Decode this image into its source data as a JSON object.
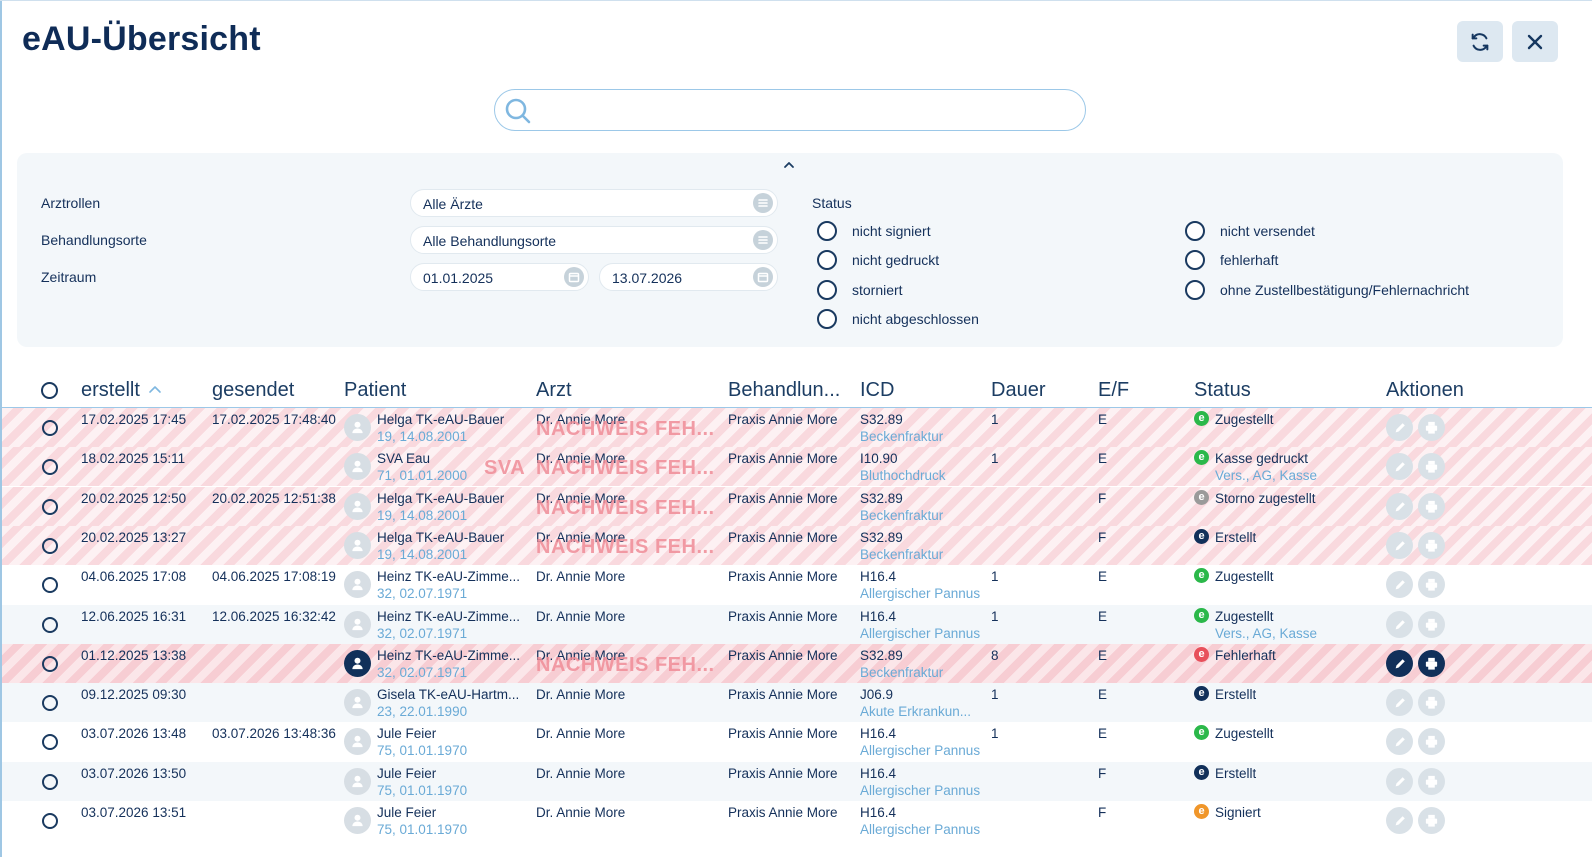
{
  "title": "eAU-Übersicht",
  "search": {
    "value": "",
    "placeholder": ""
  },
  "filters": {
    "arztrollen_label": "Arztrollen",
    "arztrollen_value": "Alle Ärzte",
    "behandlungsorte_label": "Behandlungsorte",
    "behandlungsorte_value": "Alle Behandlungsorte",
    "zeitraum_label": "Zeitraum",
    "zeitraum_from": "01.01.2025",
    "zeitraum_to": "13.07.2026",
    "status_title": "Status",
    "status_options": [
      "nicht signiert",
      "nicht gedruckt",
      "storniert",
      "nicht abgeschlossen",
      "nicht versendet",
      "fehlerhaft",
      "ohne Zustellbestätigung/Fehlernachricht"
    ]
  },
  "table": {
    "headers": [
      "erstellt",
      "gesendet",
      "Patient",
      "Arzt",
      "Behandlun...",
      "ICD",
      "Dauer",
      "E/F",
      "Status",
      "Aktionen"
    ],
    "rows": [
      {
        "erstellt": "17.02.2025 17:45",
        "gesendet": "17.02.2025 17:48:40",
        "patient": "Helga TK-eAU-Bauer",
        "patient_sub": "19, 14.08.2001",
        "arzt": "Dr. Annie More",
        "ort": "Praxis Annie More",
        "icd": "S32.89",
        "icd_sub": "Beckenfraktur",
        "dauer": "1",
        "ef": "E",
        "status": "Zugestellt",
        "status_sub": "",
        "status_color": "#2bb84a",
        "style": "err",
        "watermark": "NACHWEIS FEH...",
        "watermark_prefix": ""
      },
      {
        "erstellt": "18.02.2025 15:11",
        "gesendet": "",
        "patient": "SVA Eau",
        "patient_sub": "71, 01.01.2000",
        "arzt": "Dr. Annie More",
        "ort": "Praxis Annie More",
        "icd": "I10.90",
        "icd_sub": "Bluthochdruck",
        "dauer": "1",
        "ef": "E",
        "status": "Kasse gedruckt",
        "status_sub": "Vers., AG, Kasse",
        "status_color": "#2bb84a",
        "style": "err",
        "watermark": "NACHWEIS FEH...",
        "watermark_prefix": "SVA"
      },
      {
        "erstellt": "20.02.2025 12:50",
        "gesendet": "20.02.2025 12:51:38",
        "patient": "Helga TK-eAU-Bauer",
        "patient_sub": "19, 14.08.2001",
        "arzt": "Dr. Annie More",
        "ort": "Praxis Annie More",
        "icd": "S32.89",
        "icd_sub": "Beckenfraktur",
        "dauer": "",
        "ef": "F",
        "status": "Storno zugestellt",
        "status_sub": "",
        "status_color": "#9a9a9a",
        "style": "err",
        "watermark": "NACHWEIS FEH...",
        "watermark_prefix": ""
      },
      {
        "erstellt": "20.02.2025 13:27",
        "gesendet": "",
        "patient": "Helga TK-eAU-Bauer",
        "patient_sub": "19, 14.08.2001",
        "arzt": "Dr. Annie More",
        "ort": "Praxis Annie More",
        "icd": "S32.89",
        "icd_sub": "Beckenfraktur",
        "dauer": "",
        "ef": "F",
        "status": "Erstellt",
        "status_sub": "",
        "status_color": "#11305a",
        "style": "err",
        "watermark": "NACHWEIS FEH...",
        "watermark_prefix": ""
      },
      {
        "erstellt": "04.06.2025 17:08",
        "gesendet": "04.06.2025 17:08:19",
        "patient": "Heinz TK-eAU-Zimme...",
        "patient_sub": "32, 02.07.1971",
        "arzt": "Dr. Annie More",
        "ort": "Praxis Annie More",
        "icd": "H16.4",
        "icd_sub": "Allergischer Pannus",
        "dauer": "1",
        "ef": "E",
        "status": "Zugestellt",
        "status_sub": "",
        "status_color": "#2bb84a",
        "style": "plain",
        "watermark": "",
        "watermark_prefix": ""
      },
      {
        "erstellt": "12.06.2025 16:31",
        "gesendet": "12.06.2025 16:32:42",
        "patient": "Heinz TK-eAU-Zimme...",
        "patient_sub": "32, 02.07.1971",
        "arzt": "Dr. Annie More",
        "ort": "Praxis Annie More",
        "icd": "H16.4",
        "icd_sub": "Allergischer Pannus",
        "dauer": "1",
        "ef": "E",
        "status": "Zugestellt",
        "status_sub": "Vers., AG, Kasse",
        "status_color": "#2bb84a",
        "style": "alt",
        "watermark": "",
        "watermark_prefix": ""
      },
      {
        "erstellt": "01.12.2025 13:38",
        "gesendet": "",
        "patient": "Heinz TK-eAU-Zimme...",
        "patient_sub": "32, 02.07.1971",
        "arzt": "Dr. Annie More",
        "ort": "Praxis Annie More",
        "icd": "S32.89",
        "icd_sub": "Beckenfraktur",
        "dauer": "8",
        "ef": "E",
        "status": "Fehlerhaft",
        "status_sub": "",
        "status_color": "#e8505b",
        "style": "err active",
        "watermark": "NACHWEIS FEH...",
        "watermark_prefix": ""
      },
      {
        "erstellt": "09.12.2025 09:30",
        "gesendet": "",
        "patient": "Gisela TK-eAU-Hartm...",
        "patient_sub": "23, 22.01.1990",
        "arzt": "Dr. Annie More",
        "ort": "Praxis Annie More",
        "icd": "J06.9",
        "icd_sub": "Akute Erkrankun...",
        "dauer": "1",
        "ef": "E",
        "status": "Erstellt",
        "status_sub": "",
        "status_color": "#11305a",
        "style": "alt",
        "watermark": "",
        "watermark_prefix": ""
      },
      {
        "erstellt": "03.07.2026 13:48",
        "gesendet": "03.07.2026 13:48:36",
        "patient": "Jule Feier",
        "patient_sub": "75, 01.01.1970",
        "arzt": "Dr. Annie More",
        "ort": "Praxis Annie More",
        "icd": "H16.4",
        "icd_sub": "Allergischer Pannus",
        "dauer": "1",
        "ef": "E",
        "status": "Zugestellt",
        "status_sub": "",
        "status_color": "#2bb84a",
        "style": "plain",
        "watermark": "",
        "watermark_prefix": ""
      },
      {
        "erstellt": "03.07.2026 13:50",
        "gesendet": "",
        "patient": "Jule Feier",
        "patient_sub": "75, 01.01.1970",
        "arzt": "Dr. Annie More",
        "ort": "Praxis Annie More",
        "icd": "H16.4",
        "icd_sub": "Allergischer Pannus",
        "dauer": "",
        "ef": "F",
        "status": "Erstellt",
        "status_sub": "",
        "status_color": "#11305a",
        "style": "alt",
        "watermark": "",
        "watermark_prefix": ""
      },
      {
        "erstellt": "03.07.2026 13:51",
        "gesendet": "",
        "patient": "Jule Feier",
        "patient_sub": "75, 01.01.1970",
        "arzt": "Dr. Annie More",
        "ort": "Praxis Annie More",
        "icd": "H16.4",
        "icd_sub": "Allergischer Pannus",
        "dauer": "",
        "ef": "F",
        "status": "Signiert",
        "status_sub": "",
        "status_color": "#f0962a",
        "style": "plain",
        "watermark": "",
        "watermark_prefix": ""
      }
    ]
  }
}
